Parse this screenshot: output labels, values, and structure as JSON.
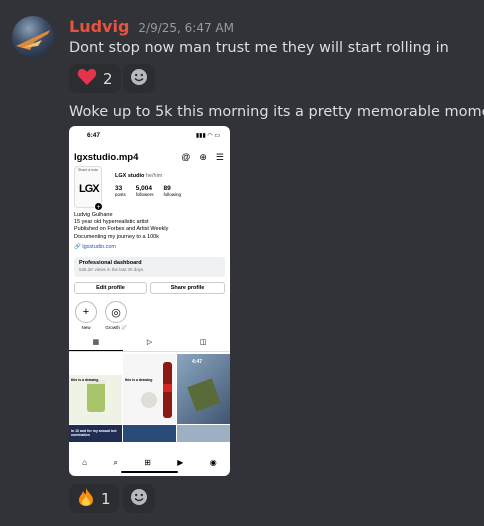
{
  "message": {
    "author": "Ludvig",
    "timestamp": "2/9/25, 6:47 AM",
    "text1": "Dont stop now man trust me they will start rolling in",
    "text2": "Woke up to 5k this morning its a pretty memorable moment"
  },
  "reactions": [
    {
      "emoji": "❤️",
      "count": "2",
      "icon": "heart-icon"
    },
    {
      "emoji": "🔥",
      "count": "1",
      "icon": "fire-icon"
    }
  ],
  "attachment": {
    "status_time": "6:47",
    "status_icons": "▮▮▮ ◠ ▭",
    "username": "lgxstudio.mp4",
    "header_icons": [
      "@",
      "⊕",
      "☰"
    ],
    "pic_share": "Share a note",
    "pic_logo": "LGX",
    "display_name": "LGX studio",
    "pronouns": "he/him",
    "stats": [
      {
        "num": "33",
        "label": "posts"
      },
      {
        "num": "5,004",
        "label": "followers"
      },
      {
        "num": "89",
        "label": "following"
      }
    ],
    "bio": [
      "Ludvig Gulhane",
      "15 year old hyperrealistic artist",
      "Published on Forbes and Artist Weekly",
      "Documenting my journey to a 100k"
    ],
    "link": "lgxstudio.com",
    "dashboard_title": "Professional dashboard",
    "dashboard_sub": "536.2K views in the last 30 days.",
    "edit_btn": "Edit profile",
    "share_btn": "Share profile",
    "highlights": [
      {
        "icon": "+",
        "label": "New"
      },
      {
        "icon": "◎",
        "label": "Growth 📈"
      }
    ],
    "grid_captions": [
      "this is a drawing",
      "this is a drawing",
      "4:47",
      "in 10 and for my annual bot nomination"
    ],
    "nav": [
      "⌂",
      "⌕",
      "⊞",
      "▶",
      "◉"
    ]
  },
  "colors": {
    "background": "#313338",
    "username": "#e8533f",
    "reaction_bg": "#2b2d31"
  }
}
